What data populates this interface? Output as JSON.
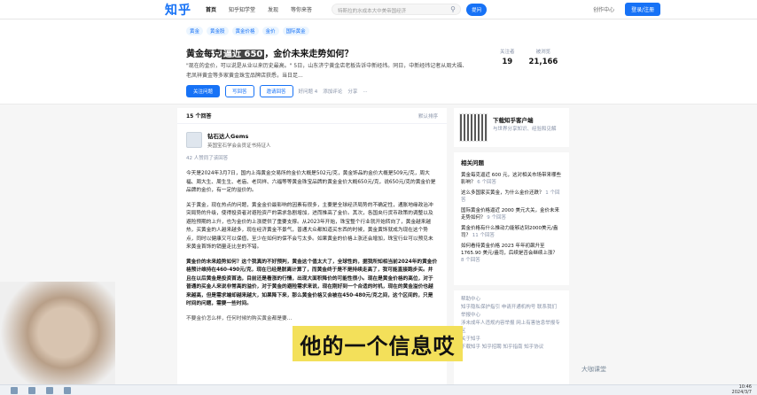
{
  "header": {
    "logo": "知乎",
    "nav": [
      "首页",
      "知乎知学堂",
      "发现",
      "等你来答"
    ],
    "search_placeholder": "特斯拉的水成本大中美帝国经济",
    "ask_label": "提问",
    "top_link": "创作中心",
    "login_label": "登录/注册"
  },
  "question": {
    "tags": [
      "黄金",
      "黄金股",
      "黄金价格",
      "金价",
      "国际黄金"
    ],
    "title_prefix": "黄金每克",
    "title_highlight": "逼近 650",
    "title_suffix": "，金价未来走势如何？",
    "description": "\"现在的金价，可以说是从业以来历史最高。\" 5日，山东济宁黄金店老板告诉中新经纬。同日，中新经纬记者从周大福、老凤祥黄金等多家黄金珠宝品牌店获悉，当日足...",
    "follow_label": "关注问题",
    "write_label": "写回答",
    "invite_label": "邀请回答",
    "actions": [
      "好问题 4",
      "添加评论",
      "分享",
      "..."
    ],
    "stats": [
      {
        "label": "关注者",
        "value": "19"
      },
      {
        "label": "被浏览",
        "value": "21,166"
      }
    ]
  },
  "answers": {
    "count_label": "15 个回答",
    "sort_label": "默认排序",
    "author_name": "钻石达人Gems",
    "author_bio": "英国宝石学会会员证书持证人",
    "likes": "42 人赞同了该回答",
    "paragraphs": [
      "今天是2024年3月7日，国内上海黄金交易所的金价大概是502元/克，黄金饰品的金价大概是509元/克，周大福、周大生、周生生、老庙、老凤祥、六福等等黄金珠宝品牌的黄金金价大概650元/克，说650元/克的黄金价是品牌的金价，有一定的溢价的。",
      "关于黄金，现在热点的问题，黄金金价最影响的因素有很多，主要是全球经济局势的不确定性，通胀地缘政治冲突局势的升级，使得投资者对避险资产的需求急剧增加，进而推高了金价。其次，各国央行货币政策的调整以及避险预期的上升，也为金价的上涨提供了重要支撑。从2023年开始，珠宝整个行业就开始转向了，黄金越来越热，买黄金的人越来越多，现在经济黄金不景气，普通大众都知道买东西的时候，黄金黄饰就成为现在这个势点，同时以健康又可以保值，至少在如何的保不会亏太多。如果黄金的价格上涨还会增加，珠宝行业可以预见未来黄金首饰的销量走比坐的不错。",
      "黄金价的未来趋势如何？这个我真的不好预判，黄金这个值太大了，全球性的，据我所知相当前2024年的黄金价格预计维持在460-490元/克，现在已经是脱离计算了，而黄金终于是不是持续走高了，我可能直接跑步买。并且在以后黄金是投资首选，目前还是看涨的行情，出现大面积降价的可能性很小。现在是黄金价格的高位，对于普通的买金人来说非常高的溢价，对于黄金的避险需求来说，现在刚好到一个合适的时机，现在的黄金溢价也越来越高，但是需求端却越来越大，如果降下来，那么黄金价格又会被在450-480元/克之间，这个区间的，只是时间的问题，需要一些时间。",
      "不要金价怎么样，任何时候的购买黄金都是要..."
    ]
  },
  "sidebar": {
    "app_title": "下载知乎客户端",
    "app_sub": "与世界分享知识、经验和见解",
    "related_title": "相关问题",
    "related": [
      {
        "q": "黄金每克逼近 600 元，这对相关市场带来哪些影响？",
        "meta": "6 个回答"
      },
      {
        "q": "这么多国家买黄金，为什么金价还跌？",
        "meta": "1 个回答"
      },
      {
        "q": "国际黄金价格逼近 2000 美元大关，金价未来走势如何？",
        "meta": "9 个回答"
      },
      {
        "q": "黄金价格有什么推动力能够达到2000美元/盎司？",
        "meta": "11 个回答"
      },
      {
        "q": "如何看待黄金价格 2023 年年初飙升至 1765.90 美元/盎司，后续是否会继续上涨？",
        "meta": "8 个回答"
      }
    ],
    "footer_links": [
      "帮助中心",
      "知乎隐私保护指引 申请开通机构号 联系我们",
      "举报中心",
      "涉未成年人违规内容举报 网上有害信息举报专区",
      "关于知乎",
      "下载知乎 知乎招聘 知乎指南 知乎协议"
    ]
  },
  "overlay": {
    "subtitle": "他的一个信息哎",
    "watermark": "大咖课堂",
    "clock_time": "10:46",
    "clock_date": "2024/3/7"
  }
}
